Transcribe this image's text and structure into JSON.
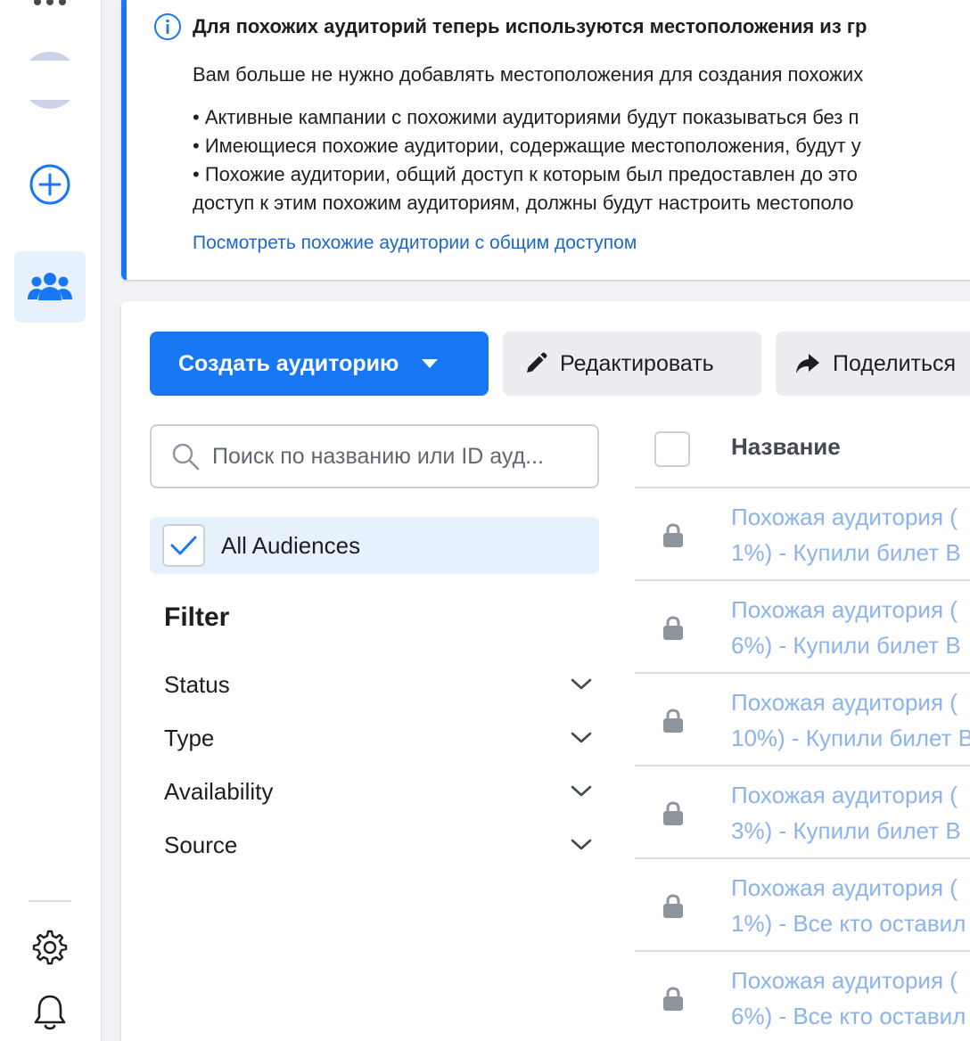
{
  "banner": {
    "title": "Для похожих аудиторий теперь используются местоположения из гр",
    "description": "Вам больше не нужно добавлять местоположения для создания похожих",
    "bullets": [
      "• Активные кампании с похожими аудиториями будут показываться без п",
      "• Имеющиеся похожие аудитории, содержащие местоположения, будут у",
      "• Похожие аудитории, общий доступ к которым был предоставлен до это"
    ],
    "bullet_continuation": "доступ к этим похожим аудиториям, должны будут настроить местополо",
    "link": "Посмотреть похожие аудитории с общим доступом"
  },
  "toolbar": {
    "create_label": "Создать аудиторию",
    "edit_label": "Редактировать",
    "share_label": "Поделиться"
  },
  "search": {
    "placeholder": "Поиск по названию или ID ауд..."
  },
  "all_audiences": {
    "label": "All Audiences"
  },
  "filter": {
    "title": "Filter",
    "items": [
      "Status",
      "Type",
      "Availability",
      "Source"
    ]
  },
  "table": {
    "header_name": "Название",
    "rows": [
      {
        "line1": "Похожая аудитория (",
        "line2": "1%) - Купили билет В"
      },
      {
        "line1": "Похожая аудитория (",
        "line2": "6%) - Купили билет В"
      },
      {
        "line1": "Похожая аудитория (",
        "line2": "10%) - Купили билет В"
      },
      {
        "line1": "Похожая аудитория (",
        "line2": "3%) - Купили билет В"
      },
      {
        "line1": "Похожая аудитория (",
        "line2": "1%) - Все кто оставил"
      },
      {
        "line1": "Похожая аудитория (",
        "line2": "6%) - Все кто оставил"
      }
    ]
  },
  "colors": {
    "accent": "#1877f2",
    "link": "#1d67c9",
    "row_link_muted": "#8ab4ea"
  }
}
